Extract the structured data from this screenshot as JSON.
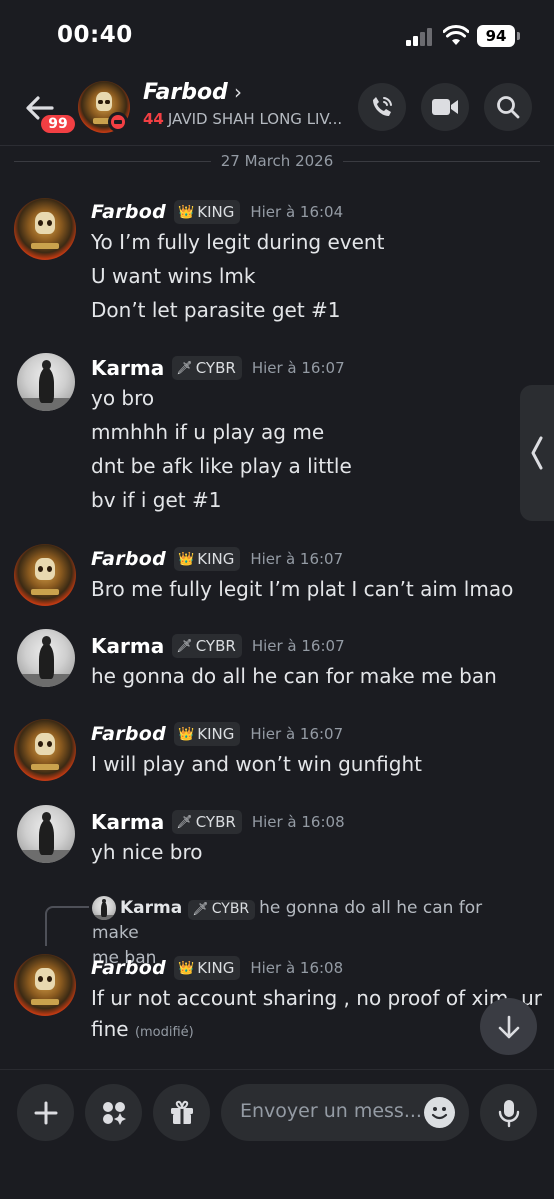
{
  "status_bar": {
    "time": "00:40",
    "battery": "94"
  },
  "header": {
    "unread_count": "99",
    "name": "Farbod",
    "chevron": "›",
    "status_text": "JAVID SHAH LONG LIV...",
    "status_emoji": "44",
    "icons": [
      "back-arrow-icon",
      "phone-call-icon",
      "video-camera-icon",
      "search-icon"
    ]
  },
  "date_divider": "27 March 2026",
  "messages": [
    {
      "author": "Farbod",
      "tag": "KING",
      "tag_icon": "crown-badge-icon",
      "time": "Hier à 16:04",
      "lines": [
        "Yo I’m fully legit during event",
        "U want wins lmk",
        "Don’t let parasite get #1"
      ]
    },
    {
      "author": "Karma",
      "tag": "CYBR",
      "tag_icon": "sword-badge-icon",
      "time": "Hier à 16:07",
      "lines": [
        "yo bro",
        "mmhhh if u play ag me",
        "dnt be afk like play a little",
        "bv if i get #1"
      ]
    },
    {
      "author": "Farbod",
      "tag": "KING",
      "tag_icon": "crown-badge-icon",
      "time": "Hier à 16:07",
      "lines": [
        "Bro me fully legit I’m plat I can’t aim lmao"
      ]
    },
    {
      "author": "Karma",
      "tag": "CYBR",
      "tag_icon": "sword-badge-icon",
      "time": "Hier à 16:07",
      "lines": [
        "he gonna do all he can for make me ban"
      ]
    },
    {
      "author": "Farbod",
      "tag": "KING",
      "tag_icon": "crown-badge-icon",
      "time": "Hier à 16:07",
      "lines": [
        "I will play and won’t win gunfight"
      ]
    },
    {
      "author": "Karma",
      "tag": "CYBR",
      "tag_icon": "sword-badge-icon",
      "time": "Hier à 16:08",
      "lines": [
        "yh nice bro"
      ]
    },
    {
      "author": "Farbod",
      "tag": "KING",
      "tag_icon": "crown-badge-icon",
      "time": "Hier à 16:08",
      "lines": [
        "If ur not account sharing , no proof of xim, ur",
        "fine"
      ],
      "edited": "(modifié)",
      "reply": {
        "author": "Karma",
        "tag": "CYBR",
        "text": "he gonna do all he can for make",
        "text2": "me ban"
      }
    }
  ],
  "composer": {
    "placeholder": "Envoyer un mess...",
    "icons": [
      "plus-icon",
      "apps-icon",
      "gift-icon",
      "emoji-icon",
      "microphone-icon"
    ]
  },
  "colors": {
    "background": "#1b1c21",
    "surface": "#2b2d31",
    "badge_red": "#f23f43",
    "muted_text": "#949ba4"
  }
}
